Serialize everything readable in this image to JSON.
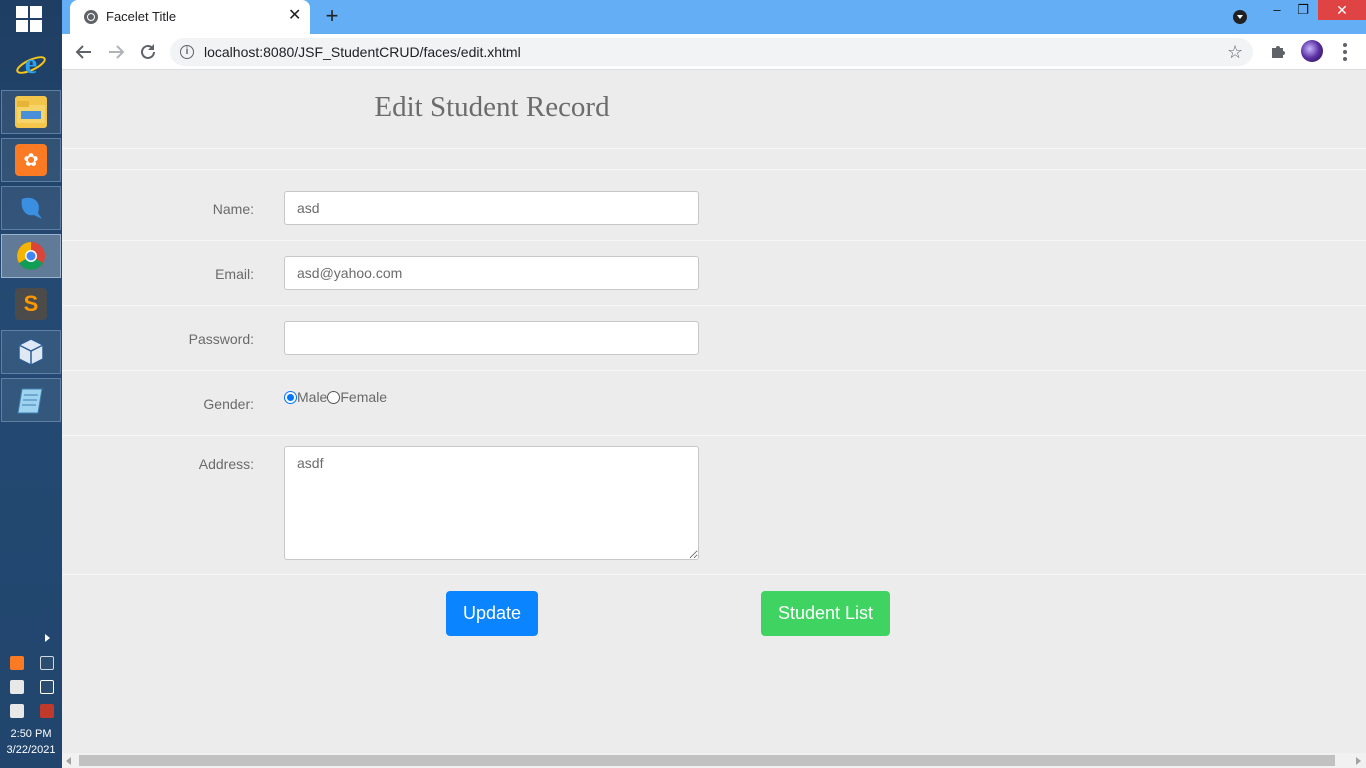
{
  "taskbar": {
    "apps": [
      {
        "name": "Internet Explorer",
        "icon": "ie-icon"
      },
      {
        "name": "File Explorer",
        "icon": "folder-icon"
      },
      {
        "name": "XAMPP",
        "icon": "xampp-icon"
      },
      {
        "name": "MySQL Workbench",
        "icon": "dolphin-icon"
      },
      {
        "name": "Google Chrome",
        "icon": "chrome-icon"
      },
      {
        "name": "Sublime Text",
        "icon": "sublime-icon"
      },
      {
        "name": "VirtualBox",
        "icon": "cube-icon"
      },
      {
        "name": "Notepad",
        "icon": "notepad-icon"
      }
    ],
    "clock": {
      "time": "2:50 PM",
      "date": "3/22/2021"
    }
  },
  "browser": {
    "tab_title": "Facelet Title",
    "tab_close": "✕",
    "new_tab": "+",
    "url": "localhost:8080/JSF_StudentCRUD/faces/edit.xhtml",
    "window_controls": {
      "minimize": "–",
      "restore": "❐",
      "close": "✕"
    }
  },
  "page": {
    "title": "Edit Student Record",
    "form": {
      "name_label": "Name:",
      "name_value": "asd",
      "email_label": "Email:",
      "email_value": "asd@yahoo.com",
      "password_label": "Password:",
      "password_value": "",
      "gender_label": "Gender:",
      "gender_options": [
        "Male",
        "Female"
      ],
      "gender_selected": "Male",
      "address_label": "Address:",
      "address_value": "asdf"
    },
    "buttons": {
      "update": "Update",
      "student_list": "Student List"
    }
  },
  "colors": {
    "tab_strip": "#64aef5",
    "update_button": "#0a84ff",
    "student_list_button": "#3fd362",
    "page_background": "#ececec"
  }
}
